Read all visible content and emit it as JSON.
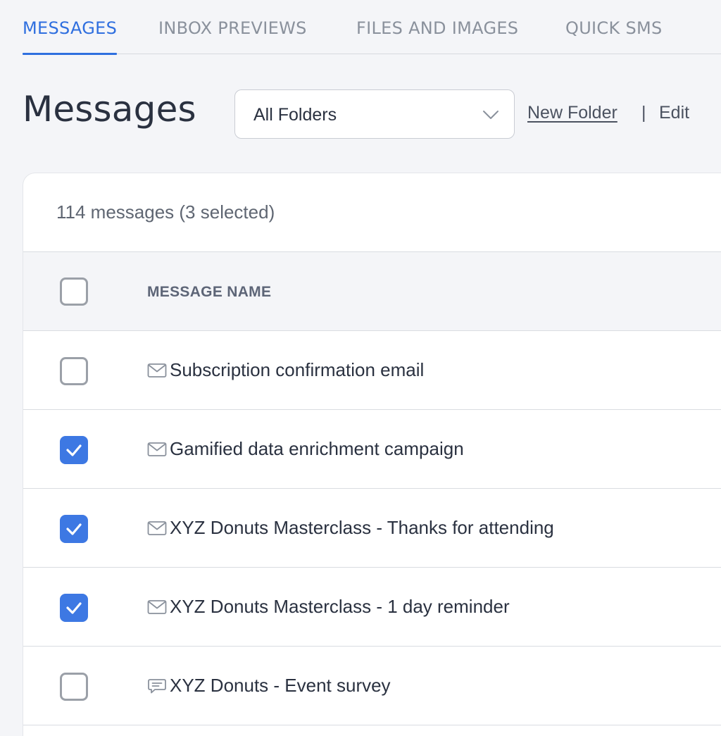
{
  "tabs": [
    {
      "label": "MESSAGES",
      "active": true
    },
    {
      "label": "INBOX PREVIEWS",
      "active": false
    },
    {
      "label": "FILES AND IMAGES",
      "active": false
    },
    {
      "label": "QUICK SMS",
      "active": false
    }
  ],
  "header": {
    "title": "Messages",
    "folder_select": {
      "value": "All Folders",
      "icon": "chevron-down-icon"
    },
    "new_folder_label": "New Folder",
    "separator": "|",
    "edit_label": "Edit"
  },
  "list": {
    "count_text": "114 messages (3 selected)",
    "column_header": "MESSAGE NAME",
    "rows": [
      {
        "name": "Subscription confirmation email",
        "type": "email",
        "icon": "envelope-icon",
        "checked": false
      },
      {
        "name": "Gamified data enrichment campaign",
        "type": "email",
        "icon": "envelope-icon",
        "checked": true
      },
      {
        "name": "XYZ Donuts Masterclass - Thanks for attending",
        "type": "email",
        "icon": "envelope-icon",
        "checked": true
      },
      {
        "name": "XYZ Donuts Masterclass - 1 day reminder",
        "type": "email",
        "icon": "envelope-icon",
        "checked": true
      },
      {
        "name": "XYZ Donuts - Event survey",
        "type": "sms",
        "icon": "chat-bubble-icon",
        "checked": false
      }
    ]
  },
  "colors": {
    "accent": "#2f6fdf",
    "checkbox_checked": "#3d78e3",
    "background": "#f4f5f8"
  }
}
